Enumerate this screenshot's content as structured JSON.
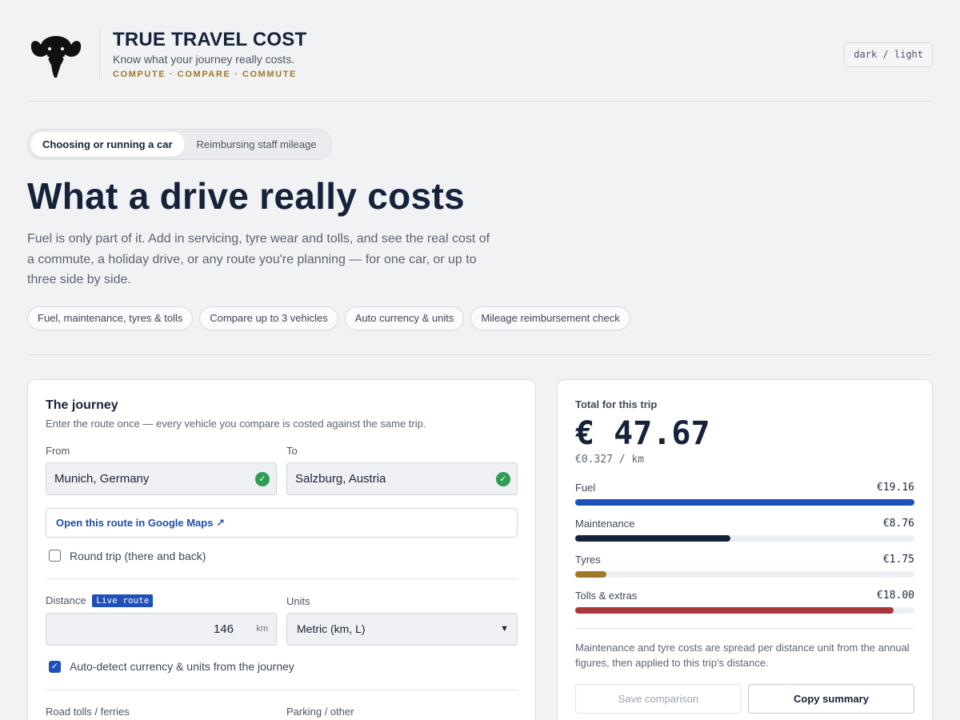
{
  "header": {
    "title": "TRUE TRAVEL COST",
    "subtitle": "Know what your journey really costs.",
    "tagline": "COMPUTE · COMPARE · COMMUTE",
    "theme_toggle": "dark / light",
    "logo_icon": "elephant-head-icon"
  },
  "tabs": [
    {
      "label": "Choosing or running a car",
      "active": true
    },
    {
      "label": "Reimbursing staff mileage",
      "active": false
    }
  ],
  "hero": {
    "title": "What a drive really costs",
    "description": "Fuel is only part of it. Add in servicing, tyre wear and tolls, and see the real cost of a commute, a holiday drive, or any route you're planning — for one car, or up to three side by side."
  },
  "chips": [
    "Fuel, maintenance, tyres & tolls",
    "Compare up to 3 vehicles",
    "Auto currency & units",
    "Mileage reimbursement check"
  ],
  "journey": {
    "title": "The journey",
    "subtitle": "Enter the route once — every vehicle you compare is costed against the same trip.",
    "from_label": "From",
    "from_value": "Munich, Germany",
    "to_label": "To",
    "to_value": "Salzburg, Austria",
    "map_link": "Open this route in Google Maps ↗",
    "round_trip_label": "Round trip (there and back)",
    "round_trip_checked": false,
    "distance_label": "Distance",
    "distance_badge": "Live route",
    "distance_value": "146",
    "distance_unit": "km",
    "units_label": "Units",
    "units_value": "Metric (km, L)",
    "auto_detect_label": "Auto-detect currency & units from the journey",
    "auto_detect_checked": true,
    "tolls_label": "Road tolls / ferries",
    "parking_label": "Parking / other"
  },
  "total": {
    "label": "Total for this trip",
    "amount": "€ 47.67",
    "per_km": "€0.327 / km",
    "rows": [
      {
        "name": "Fuel",
        "value": "€19.16",
        "amount": 19.16,
        "color": "#1f4fb8"
      },
      {
        "name": "Maintenance",
        "value": "€8.76",
        "amount": 8.76,
        "color": "#16223a"
      },
      {
        "name": "Tyres",
        "value": "€1.75",
        "amount": 1.75,
        "color": "#a07828"
      },
      {
        "name": "Tolls & extras",
        "value": "€18.00",
        "amount": 18.0,
        "color": "#a8363a"
      }
    ],
    "note": "Maintenance and tyre costs are spread per distance unit from the annual figures, then applied to this trip's distance.",
    "save_button": "Save comparison",
    "copy_button": "Copy summary"
  }
}
